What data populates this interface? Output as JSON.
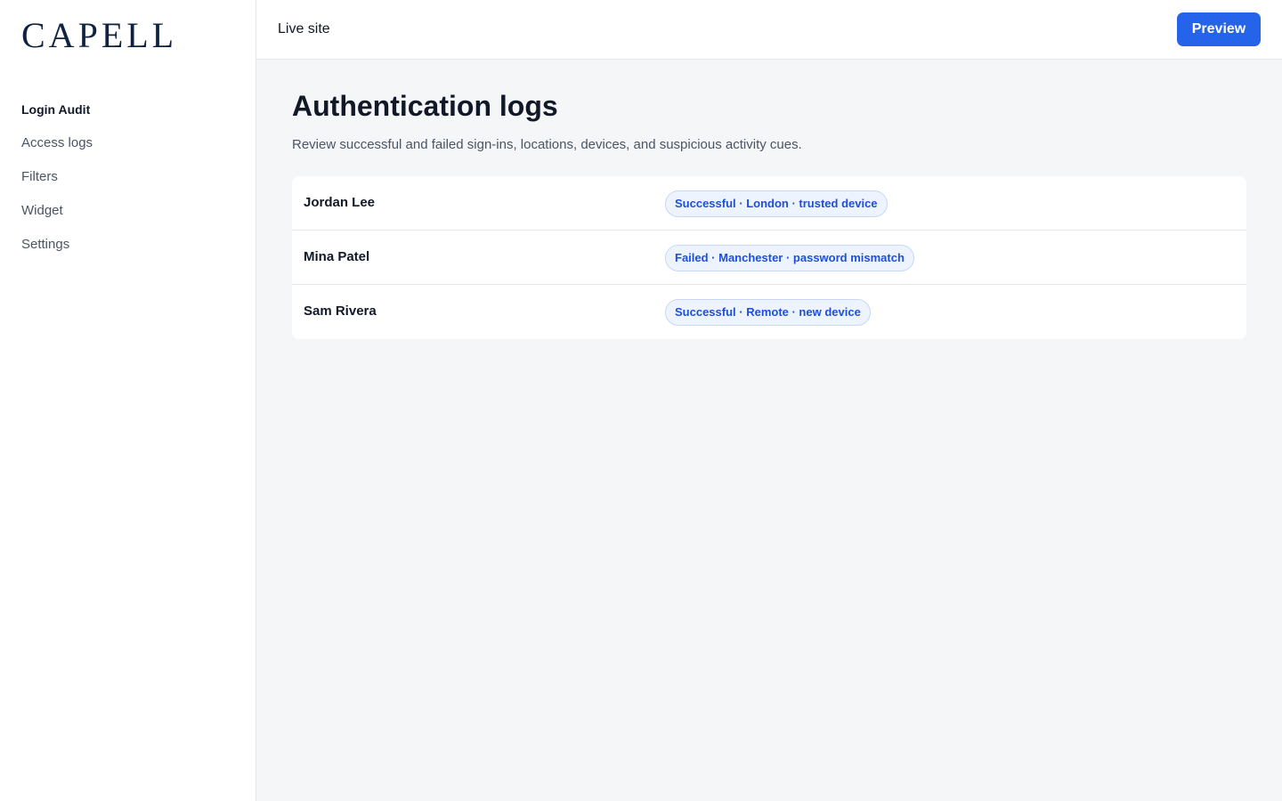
{
  "brand": {
    "logo_text": "CAPELL"
  },
  "sidebar": {
    "items": [
      {
        "label": "Login Audit",
        "active": true
      },
      {
        "label": "Access logs"
      },
      {
        "label": "Filters"
      },
      {
        "label": "Widget"
      },
      {
        "label": "Settings"
      }
    ]
  },
  "topbar": {
    "live_site": "Live site",
    "preview_label": "Preview"
  },
  "main": {
    "title": "Authentication logs",
    "subtitle": "Review successful and failed sign-ins, locations, devices, and suspicious activity cues."
  },
  "logs": [
    {
      "name": "Jordan Lee",
      "status": "Successful · London · trusted device"
    },
    {
      "name": "Mina Patel",
      "status": "Failed · Manchester · password mismatch"
    },
    {
      "name": "Sam Rivera",
      "status": "Successful · Remote · new device"
    }
  ],
  "colors": {
    "accent": "#2563eb",
    "badge_text": "#1d4fd8",
    "badge_bg": "#eef4ff",
    "brand": "#0f2340"
  }
}
